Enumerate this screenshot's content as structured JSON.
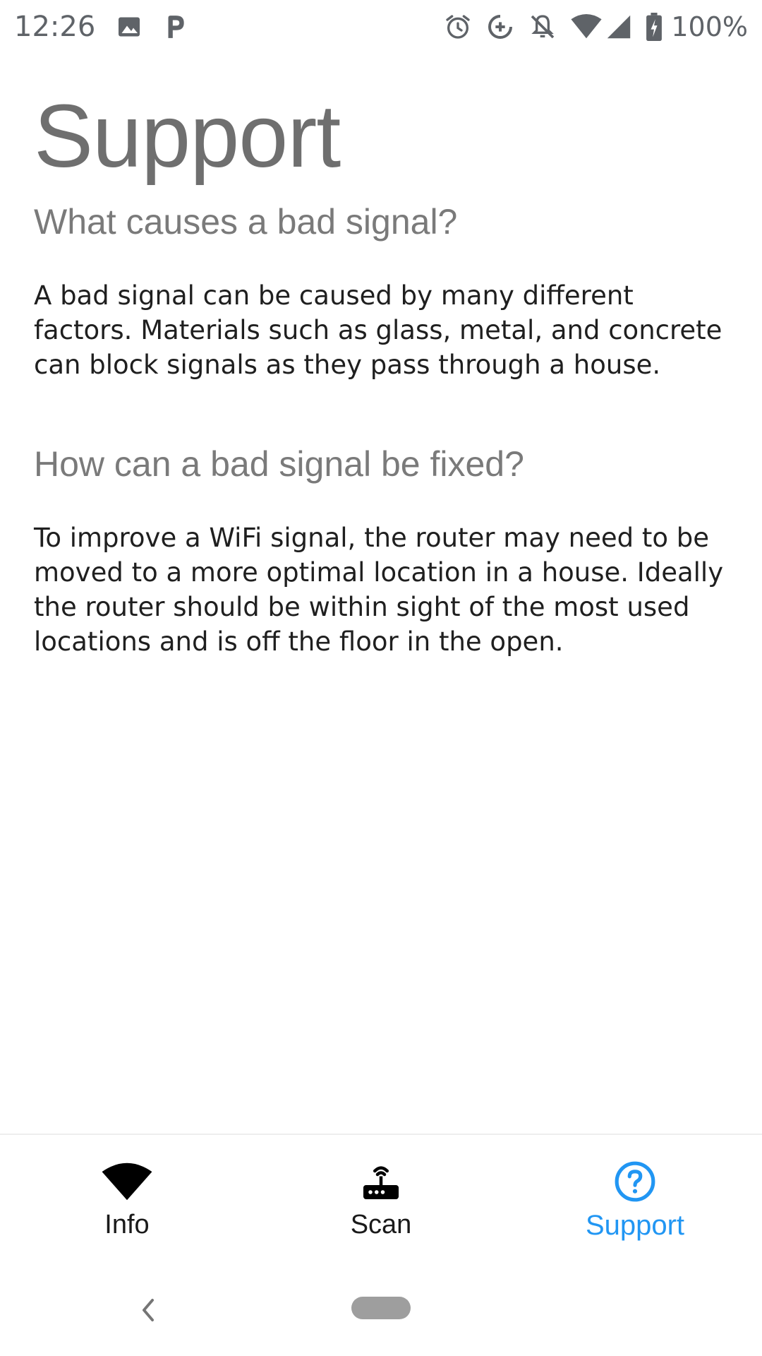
{
  "status_bar": {
    "time": "12:26",
    "battery_percent": "100%",
    "left_icons": [
      "image-icon",
      "parking-icon"
    ],
    "right_icons": [
      "alarm-icon",
      "data-saver-icon",
      "notifications-off-icon",
      "wifi-icon",
      "cell-signal-icon",
      "battery-charging-icon"
    ]
  },
  "page": {
    "title": "Support",
    "sections": [
      {
        "question": "What causes a bad signal?",
        "answer": "A bad signal can be caused by many different factors. Materials such as glass, metal, and concrete can block signals as they pass through a house."
      },
      {
        "question": "How can a bad signal be fixed?",
        "answer": "To improve a WiFi signal, the router may need to be moved to a more optimal location in a house. Ideally the router should be within sight of the most used locations and is off the floor in the open."
      }
    ]
  },
  "bottom_nav": {
    "items": [
      {
        "label": "Info",
        "icon": "wifi-icon",
        "active": false
      },
      {
        "label": "Scan",
        "icon": "router-icon",
        "active": false
      },
      {
        "label": "Support",
        "icon": "help-circle-icon",
        "active": true
      }
    ]
  },
  "colors": {
    "accent": "#2196F3",
    "title": "#6f6f6f",
    "body_text": "#1f1f1f",
    "status": "#5f6368"
  }
}
